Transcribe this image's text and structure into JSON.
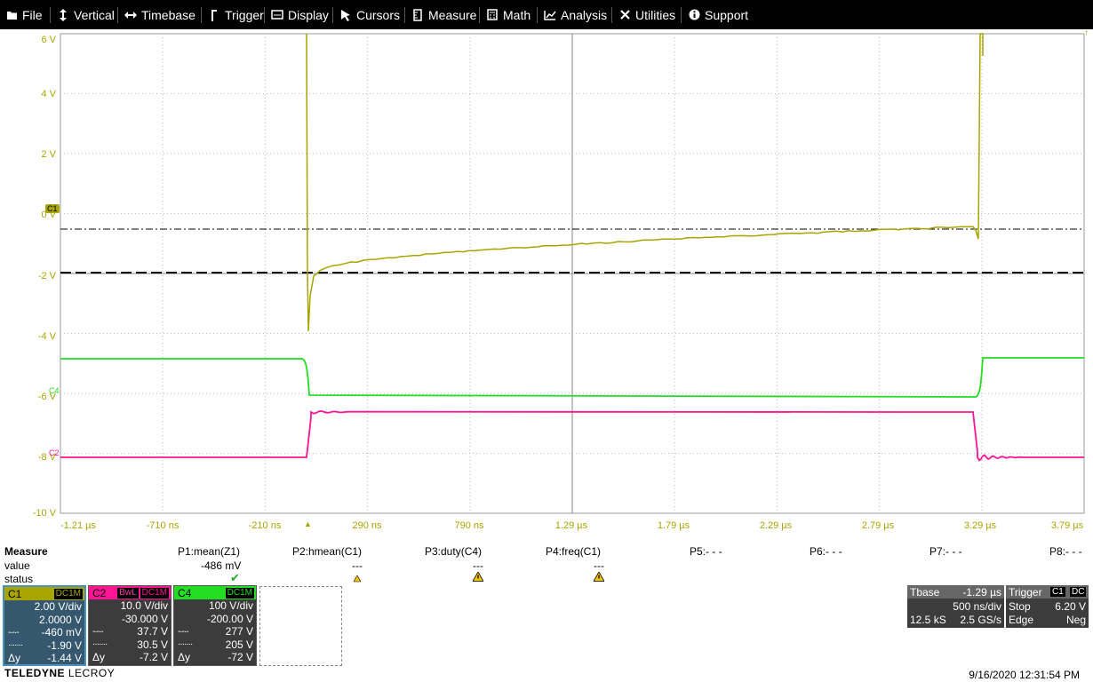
{
  "menu": [
    {
      "label": "File",
      "icon": "folder-icon"
    },
    {
      "label": "Vertical",
      "icon": "vertical-arrows-icon"
    },
    {
      "label": "Timebase",
      "icon": "horizontal-arrows-icon"
    },
    {
      "label": "Trigger",
      "icon": "trigger-icon"
    },
    {
      "label": "Display",
      "icon": "display-icon"
    },
    {
      "label": "Cursors",
      "icon": "cursor-icon"
    },
    {
      "label": "Measure",
      "icon": "measure-icon"
    },
    {
      "label": "Math",
      "icon": "calculator-icon"
    },
    {
      "label": "Analysis",
      "icon": "analysis-icon"
    },
    {
      "label": "Utilities",
      "icon": "wrench-icon"
    },
    {
      "label": "Support",
      "icon": "info-icon"
    }
  ],
  "grid": {
    "y_labels": [
      "6 V",
      "4 V",
      "2 V",
      "0 V",
      "-2 V",
      "-4 V",
      "-6 V",
      "-8 V",
      "-10 V"
    ],
    "x_labels": [
      "-1.21 µs",
      "-710 ns",
      "-210 ns",
      "290 ns",
      "790 ns",
      "1.29 µs",
      "1.79 µs",
      "2.29 µs",
      "2.79 µs",
      "3.29 µs",
      "3.79 µs"
    ],
    "markers": {
      "c1": "C1",
      "c4": "C4",
      "c2": "C2"
    },
    "colors": {
      "c1": "#a8a400",
      "c2": "#ff1493",
      "c4": "#22dd22"
    }
  },
  "measure": {
    "title": "Measure",
    "row_labels": [
      "value",
      "status"
    ],
    "params": [
      {
        "name": "P1:mean(Z1)",
        "value": "-486 mV",
        "status": "ok"
      },
      {
        "name": "P2:hmean(C1)",
        "value": "---",
        "status": "warn-small"
      },
      {
        "name": "P3:duty(C4)",
        "value": "---",
        "status": "warn"
      },
      {
        "name": "P4:freq(C1)",
        "value": "---",
        "status": "warn"
      },
      {
        "name": "P5:- - -"
      },
      {
        "name": "P6:- - -"
      },
      {
        "name": "P7:- - -"
      },
      {
        "name": "P8:- - -"
      }
    ]
  },
  "channels": [
    {
      "name": "C1",
      "coupling": "DC1M",
      "bwl": "",
      "color": "#a8a400",
      "vdiv": "2.00 V/div",
      "offset": "2.0000 V",
      "cur1": "-460 mV",
      "cur2": "-1.90 V",
      "dy": "-1.44 V"
    },
    {
      "name": "C2",
      "coupling": "DC1M",
      "bwl": "BwL",
      "color": "#ff1493",
      "vdiv": "10.0 V/div",
      "offset": "-30.000 V",
      "cur1": "37.7 V",
      "cur2": "30.5 V",
      "dy": "-7.2 V"
    },
    {
      "name": "C4",
      "coupling": "DC1M",
      "bwl": "",
      "color": "#22dd22",
      "vdiv": "100 V/div",
      "offset": "-200.00 V",
      "cur1": "277 V",
      "cur2": "205 V",
      "dy": "-72 V"
    }
  ],
  "cursor_labels": {
    "c1": "-·-·-",
    "c2": "·······",
    "dy": "Δy"
  },
  "timebase": {
    "label": "Tbase",
    "delay": "-1.29 µs",
    "tdiv": "500 ns/div",
    "samples": "12.5 kS",
    "rate": "2.5 GS/s"
  },
  "trigger": {
    "label": "Trigger",
    "source": "C1",
    "coupling": "DC",
    "mode": "Stop",
    "level": "6.20 V",
    "type": "Edge",
    "slope": "Neg"
  },
  "brand": {
    "name": "TELEDYNE",
    "sub": "LECROY"
  },
  "datetime": "9/16/2020 12:31:54 PM"
}
